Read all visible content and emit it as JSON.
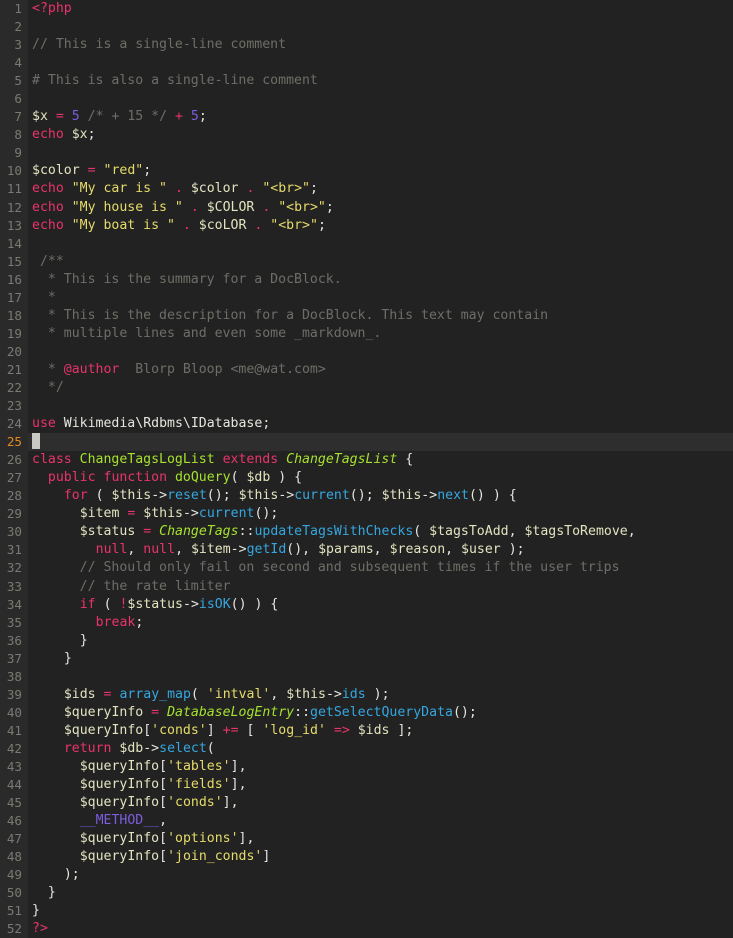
{
  "editor": {
    "language": "PHP",
    "theme": "dark",
    "total_lines": 52,
    "active_line": 25,
    "cursor": {
      "line": 25,
      "column": 1
    },
    "colors": {
      "background": "#222222",
      "gutter_background": "#2a2a2a",
      "active_line_background": "#2e2e2e",
      "line_number": "#7a7a72",
      "active_line_number": "#e08a21",
      "foreground": "#d8d8d2",
      "keyword": "#e8346b",
      "comment": "#6e6e68",
      "string": "#e6db6a",
      "variable": "#e3e3c0",
      "number": "#7b5ede",
      "method": "#35a7e0",
      "class": "#a6e22e",
      "cursor": "#c9c9c4"
    }
  },
  "lines": [
    {
      "n": "1",
      "text": "<?php"
    },
    {
      "n": "2",
      "text": ""
    },
    {
      "n": "3",
      "text": "// This is a single-line comment"
    },
    {
      "n": "4",
      "text": ""
    },
    {
      "n": "5",
      "text": "# This is also a single-line comment"
    },
    {
      "n": "6",
      "text": ""
    },
    {
      "n": "7",
      "text": "$x = 5 /* + 15 */ + 5;"
    },
    {
      "n": "8",
      "text": "echo $x;"
    },
    {
      "n": "9",
      "text": ""
    },
    {
      "n": "10",
      "text": "$color = \"red\";"
    },
    {
      "n": "11",
      "text": "echo \"My car is \" . $color . \"<br>\";"
    },
    {
      "n": "12",
      "text": "echo \"My house is \" . $COLOR . \"<br>\";"
    },
    {
      "n": "13",
      "text": "echo \"My boat is \" . $coLOR . \"<br>\";"
    },
    {
      "n": "14",
      "text": ""
    },
    {
      "n": "15",
      "text": " /**"
    },
    {
      "n": "16",
      "text": "  * This is the summary for a DocBlock."
    },
    {
      "n": "17",
      "text": "  *"
    },
    {
      "n": "18",
      "text": "  * This is the description for a DocBlock. This text may contain"
    },
    {
      "n": "19",
      "text": "  * multiple lines and even some _markdown_."
    },
    {
      "n": "20",
      "text": ""
    },
    {
      "n": "21",
      "text": "  * @author  Blorp Bloop <me@wat.com>"
    },
    {
      "n": "22",
      "text": "  */"
    },
    {
      "n": "23",
      "text": ""
    },
    {
      "n": "24",
      "text": "use Wikimedia\\Rdbms\\IDatabase;"
    },
    {
      "n": "25",
      "text": ""
    },
    {
      "n": "26",
      "text": "class ChangeTagsLogList extends ChangeTagsList {"
    },
    {
      "n": "27",
      "text": "  public function doQuery( $db ) {"
    },
    {
      "n": "28",
      "text": "    for ( $this->reset(); $this->current(); $this->next() ) {"
    },
    {
      "n": "29",
      "text": "      $item = $this->current();"
    },
    {
      "n": "30",
      "text": "      $status = ChangeTags::updateTagsWithChecks( $tagsToAdd, $tagsToRemove,"
    },
    {
      "n": "31",
      "text": "        null, null, $item->getId(), $params, $reason, $user );"
    },
    {
      "n": "32",
      "text": "      // Should only fail on second and subsequent times if the user trips"
    },
    {
      "n": "33",
      "text": "      // the rate limiter"
    },
    {
      "n": "34",
      "text": "      if ( !$status->isOK() ) {"
    },
    {
      "n": "35",
      "text": "        break;"
    },
    {
      "n": "36",
      "text": "      }"
    },
    {
      "n": "37",
      "text": "    }"
    },
    {
      "n": "38",
      "text": ""
    },
    {
      "n": "39",
      "text": "    $ids = array_map( 'intval', $this->ids );"
    },
    {
      "n": "40",
      "text": "    $queryInfo = DatabaseLogEntry::getSelectQueryData();"
    },
    {
      "n": "41",
      "text": "    $queryInfo['conds'] += [ 'log_id' => $ids ];"
    },
    {
      "n": "42",
      "text": "    return $db->select("
    },
    {
      "n": "43",
      "text": "      $queryInfo['tables'],"
    },
    {
      "n": "44",
      "text": "      $queryInfo['fields'],"
    },
    {
      "n": "45",
      "text": "      $queryInfo['conds'],"
    },
    {
      "n": "46",
      "text": "      __METHOD__,"
    },
    {
      "n": "47",
      "text": "      $queryInfo['options'],"
    },
    {
      "n": "48",
      "text": "      $queryInfo['join_conds']"
    },
    {
      "n": "49",
      "text": "    );"
    },
    {
      "n": "50",
      "text": "  }"
    },
    {
      "n": "51",
      "text": "}"
    },
    {
      "n": "52",
      "text": "?>"
    }
  ]
}
